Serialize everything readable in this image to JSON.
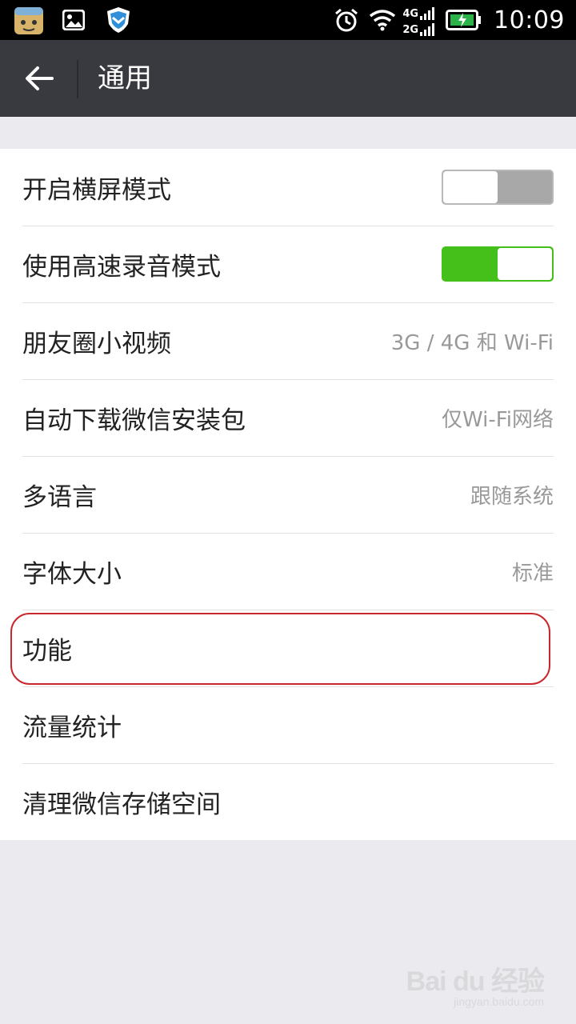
{
  "status_bar": {
    "time": "10:09",
    "net_top": "4G",
    "net_bottom": "2G",
    "icons": [
      "app-avatar-icon",
      "gallery-icon",
      "shield-icon",
      "alarm-icon",
      "wifi-icon",
      "signal-icon",
      "battery-icon"
    ]
  },
  "header": {
    "title": "通用",
    "back_icon": "arrow-left-icon"
  },
  "settings": {
    "landscape": {
      "label": "开启横屏模式",
      "on": false
    },
    "hq_record": {
      "label": "使用高速录音模式",
      "on": true
    },
    "moments_video": {
      "label": "朋友圈小视频",
      "value": "3G / 4G 和 Wi-Fi"
    },
    "auto_download": {
      "label": "自动下载微信安装包",
      "value": "仅Wi-Fi网络"
    },
    "language": {
      "label": "多语言",
      "value": "跟随系统"
    },
    "font_size": {
      "label": "字体大小",
      "value": "标准"
    },
    "features": {
      "label": "功能"
    },
    "traffic": {
      "label": "流量统计"
    },
    "storage": {
      "label": "清理微信存储空间"
    }
  },
  "watermark": {
    "logo": "Bai du 经验",
    "url": "jingyan.baidu.com"
  },
  "colors": {
    "accent_green": "#45c01a",
    "header_bg": "#393a3f",
    "highlight_red": "#c9282d"
  }
}
